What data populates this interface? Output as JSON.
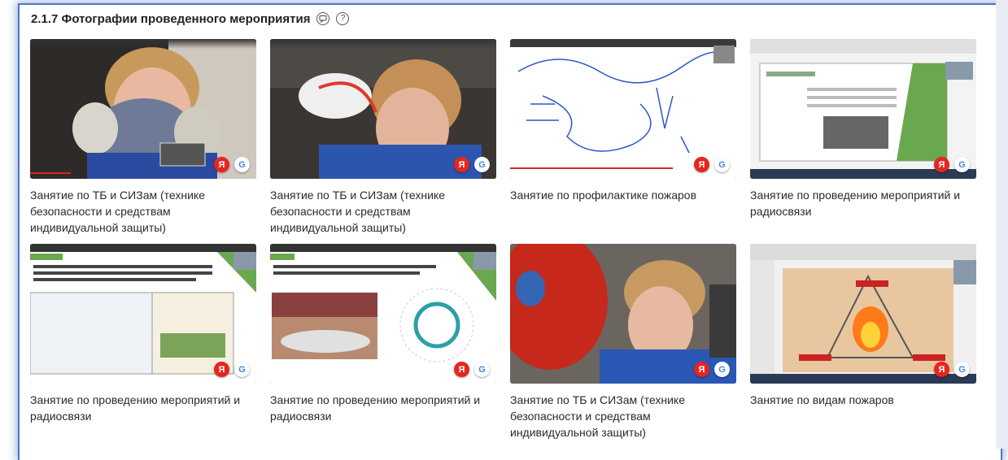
{
  "section": {
    "title": "2.1.7 Фотографии проведенного мероприятия",
    "info_icon_label": "?"
  },
  "badges": {
    "yandex": "Я",
    "google": "G"
  },
  "photos": [
    {
      "caption": "Занятие по ТБ и СИЗам (технике безопасности и средствам индивидуальной защиты)"
    },
    {
      "caption": "Занятие по ТБ и СИЗам (технике безопасности и средствам индивидуальной защиты)"
    },
    {
      "caption": "Занятие по профилактике пожаров"
    },
    {
      "caption": "Занятие по проведению мероприятий и радиосвязи"
    },
    {
      "caption": "Занятие по проведению мероприятий и радиосвязи"
    },
    {
      "caption": "Занятие по проведению мероприятий и радиосвязи"
    },
    {
      "caption": "Занятие по ТБ и СИЗам (технике безопасности и средствам индивидуальной защиты)"
    },
    {
      "caption": "Занятие по видам пожаров"
    }
  ],
  "colors": {
    "frame": "#4a78c8",
    "accent_red": "#d22020",
    "slide_green": "#6aa84f"
  }
}
